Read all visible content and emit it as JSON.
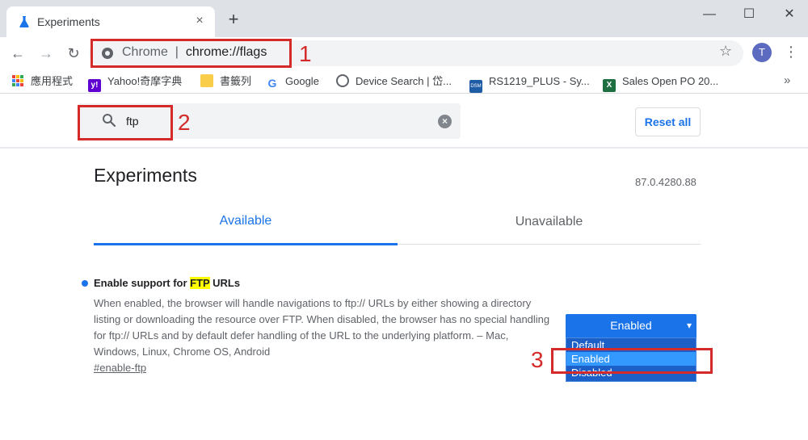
{
  "tab": {
    "title": "Experiments",
    "close": "×",
    "new_tab": "+"
  },
  "window": {
    "minimize": "—",
    "maximize": "☐",
    "close": "✕"
  },
  "toolbar": {
    "back": "←",
    "forward": "→",
    "reload": "↻",
    "omnibox_site": "Chrome",
    "omnibox_separator": "|",
    "omnibox_url": "chrome://flags",
    "star": "☆",
    "avatar": "T",
    "menu": "⋮"
  },
  "bookmarks": {
    "items": [
      {
        "label": "應用程式",
        "icon": "apps-grid-icon"
      },
      {
        "label": "Yahoo!奇摩字典",
        "icon": "yahoo-icon"
      },
      {
        "label": "書籤列",
        "icon": "folder-icon"
      },
      {
        "label": "Google",
        "icon": "google-icon"
      },
      {
        "label": "Device Search | 岱...",
        "icon": "device-search-icon"
      },
      {
        "label": "RS1219_PLUS - Sy...",
        "icon": "dsm-icon"
      },
      {
        "label": "Sales Open PO 20...",
        "icon": "excel-icon"
      }
    ],
    "more": "»"
  },
  "search": {
    "value": "ftp",
    "clear": "×"
  },
  "reset_label": "Reset all",
  "page": {
    "title": "Experiments",
    "version": "87.0.4280.88",
    "tabs": {
      "available": "Available",
      "unavailable": "Unavailable"
    }
  },
  "experiment": {
    "title_before": "Enable support for ",
    "title_highlight": "FTP",
    "title_after": " URLs",
    "description": "When enabled, the browser will handle navigations to ftp:// URLs by either showing a directory listing or downloading the resource over FTP. When disabled, the browser has no special handling for ftp:// URLs and by default defer handling of the URL to the underlying platform. – Mac, Windows, Linux, Chrome OS, Android",
    "link": "#enable-ftp",
    "select_value": "Enabled",
    "options": [
      "Default",
      "Enabled",
      "Disabled"
    ],
    "selected_option": "Enabled"
  },
  "annotations": [
    "1",
    "2",
    "3"
  ],
  "colors": {
    "accent": "#1a73e8",
    "annotation": "#d42a2a",
    "highlight": "#ffff00"
  }
}
